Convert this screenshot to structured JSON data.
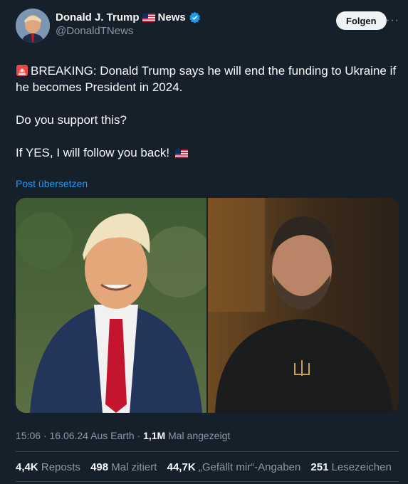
{
  "author": {
    "display_name": "Donald J. Trump",
    "name_suffix": "News",
    "handle": "@DonaldTNews",
    "flag_icon": "us-flag-icon",
    "verified_color": "#1d9bf0"
  },
  "follow_label": "Folgen",
  "more_label": "···",
  "tweet": {
    "line1": "BREAKING: Donald Trump says he will end the funding to Ukraine if he becomes President in 2024.",
    "line2": "Do you support this?",
    "line3": "If YES, I will follow you back!"
  },
  "translate_label": "Post übersetzen",
  "meta": {
    "time": "15:06",
    "sep1": "·",
    "date": "16.06.24",
    "source": "Aus Earth",
    "sep2": "·",
    "views_count": "1,1M",
    "views_label": "Mal angezeigt"
  },
  "stats": {
    "reposts_count": "4,4K",
    "reposts_label": "Reposts",
    "quotes_count": "498",
    "quotes_label": "Mal zitiert",
    "likes_count": "44,7K",
    "likes_label": "„Gefällt mir“-Angaben",
    "bookmarks_count": "251",
    "bookmarks_label": "Lesezeichen"
  }
}
